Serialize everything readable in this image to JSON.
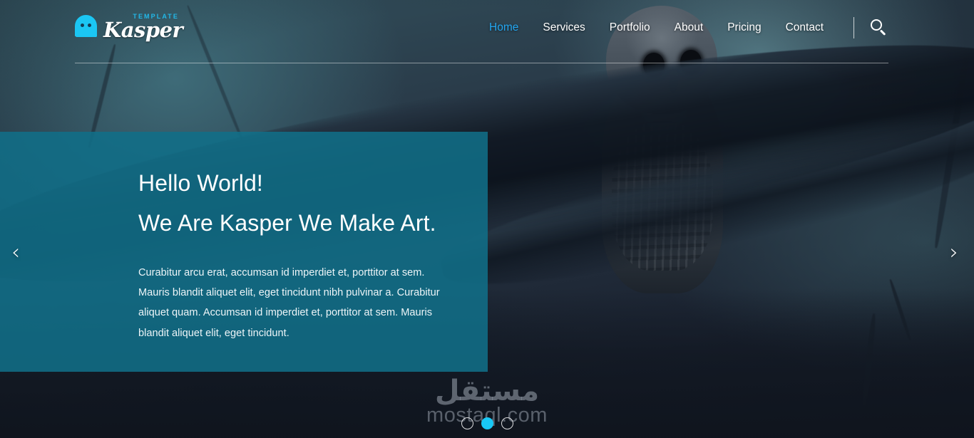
{
  "brand": {
    "ghost_icon": "ghost-icon",
    "template_label": "TEMPLATE",
    "name": "Kasper",
    "accent_color": "#1bc6f3"
  },
  "nav": {
    "items": [
      {
        "label": "Home",
        "active": true
      },
      {
        "label": "Services",
        "active": false
      },
      {
        "label": "Portfolio",
        "active": false
      },
      {
        "label": "About",
        "active": false
      },
      {
        "label": "Pricing",
        "active": false
      },
      {
        "label": "Contact",
        "active": false
      }
    ],
    "active_color": "#23a6f0",
    "search_icon": "search-icon"
  },
  "slider": {
    "panel_color": "#116e88",
    "heading_line1": "Hello World!",
    "heading_line2": "We Are Kasper We Make Art.",
    "body": "Curabitur arcu erat, accumsan id imperdiet et, porttitor at sem. Mauris blandit aliquet elit, eget tincidunt nibh pulvinar a. Curabitur aliquet quam. Accumsan id imperdiet et, porttitor at sem. Mauris blandit aliquet elit, eget tincidunt.",
    "prev_label": "‹",
    "next_label": "›",
    "bullets": [
      {
        "active": false
      },
      {
        "active": true
      },
      {
        "active": false
      }
    ],
    "bullet_active_color": "#19c8f5"
  },
  "watermark": {
    "arabic": "مستقل",
    "latin": "mostaql.com"
  }
}
